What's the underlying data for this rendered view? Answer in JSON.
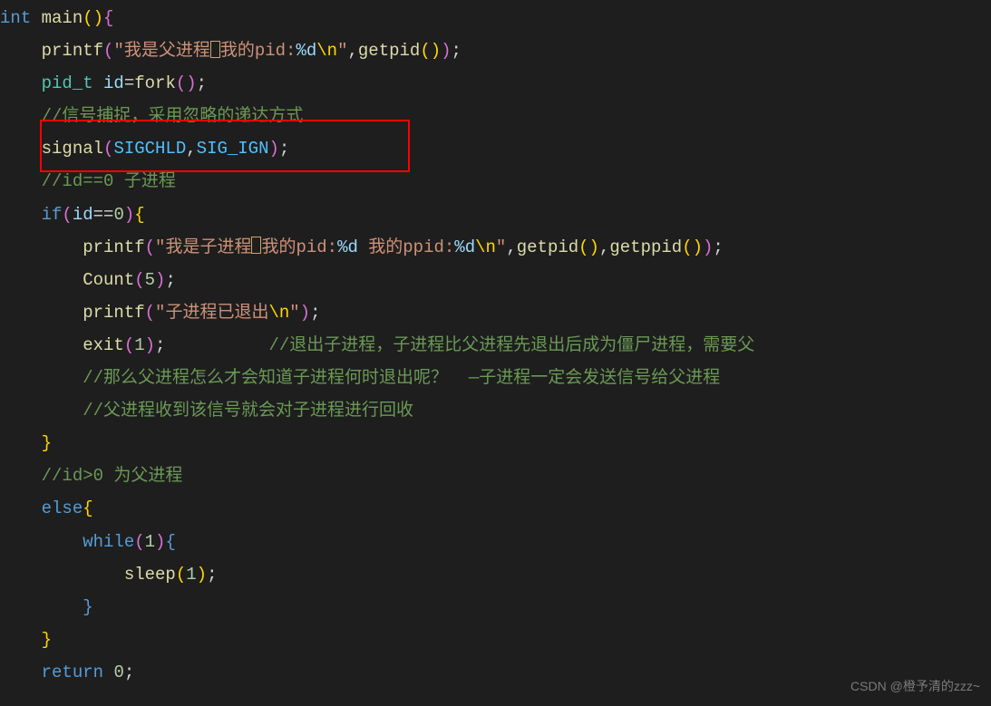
{
  "lines": [
    {
      "indent": "",
      "tokens": [
        {
          "t": "int ",
          "c": "kw"
        },
        {
          "t": "main",
          "c": "fn"
        },
        {
          "t": "()",
          "c": "brace2"
        },
        {
          "t": "{",
          "c": "brace"
        }
      ]
    },
    {
      "indent": "    ",
      "tokens": [
        {
          "t": "printf",
          "c": "fn"
        },
        {
          "t": "(",
          "c": "brace"
        },
        {
          "t": "\"我是父进程",
          "c": "str"
        },
        {
          "t": "",
          "c": "highlight-box"
        },
        {
          "t": "我的pid:",
          "c": "str"
        },
        {
          "t": "%d",
          "c": "var"
        },
        {
          "t": "\\n",
          "c": "brace2"
        },
        {
          "t": "\"",
          "c": "str"
        },
        {
          "t": ",",
          "c": "punct"
        },
        {
          "t": "getpid",
          "c": "fn"
        },
        {
          "t": "()",
          "c": "brace2"
        },
        {
          "t": ")",
          "c": "brace"
        },
        {
          "t": ";",
          "c": "punct"
        }
      ]
    },
    {
      "indent": "    ",
      "tokens": [
        {
          "t": "pid_t",
          "c": "type"
        },
        {
          "t": " ",
          "c": "punct"
        },
        {
          "t": "id",
          "c": "var"
        },
        {
          "t": "=",
          "c": "punct"
        },
        {
          "t": "fork",
          "c": "fn"
        },
        {
          "t": "()",
          "c": "brace"
        },
        {
          "t": ";",
          "c": "punct"
        }
      ]
    },
    {
      "indent": "    ",
      "tokens": [
        {
          "t": "//信号捕捉，采用忽略的递达方式",
          "c": "cmt"
        }
      ]
    },
    {
      "indent": "    ",
      "tokens": [
        {
          "t": "signal",
          "c": "fn"
        },
        {
          "t": "(",
          "c": "brace"
        },
        {
          "t": "SIGCHLD",
          "c": "const"
        },
        {
          "t": ",",
          "c": "punct"
        },
        {
          "t": "SIG_IGN",
          "c": "const"
        },
        {
          "t": ")",
          "c": "brace"
        },
        {
          "t": ";",
          "c": "punct"
        }
      ]
    },
    {
      "indent": "",
      "tokens": []
    },
    {
      "indent": "    ",
      "tokens": [
        {
          "t": "//id==0 子进程",
          "c": "cmt"
        }
      ]
    },
    {
      "indent": "    ",
      "tokens": [
        {
          "t": "if",
          "c": "kw"
        },
        {
          "t": "(",
          "c": "brace"
        },
        {
          "t": "id",
          "c": "var"
        },
        {
          "t": "==",
          "c": "punct"
        },
        {
          "t": "0",
          "c": "num"
        },
        {
          "t": ")",
          "c": "brace"
        },
        {
          "t": "{",
          "c": "brace2"
        }
      ]
    },
    {
      "indent": "        ",
      "tokens": [
        {
          "t": "printf",
          "c": "fn"
        },
        {
          "t": "(",
          "c": "brace"
        },
        {
          "t": "\"我是子进程",
          "c": "str"
        },
        {
          "t": "",
          "c": "highlight-box"
        },
        {
          "t": "我的pid:",
          "c": "str"
        },
        {
          "t": "%d",
          "c": "var"
        },
        {
          "t": " 我的ppid:",
          "c": "str"
        },
        {
          "t": "%d",
          "c": "var"
        },
        {
          "t": "\\n",
          "c": "brace2"
        },
        {
          "t": "\"",
          "c": "str"
        },
        {
          "t": ",",
          "c": "punct"
        },
        {
          "t": "getpid",
          "c": "fn"
        },
        {
          "t": "()",
          "c": "brace2"
        },
        {
          "t": ",",
          "c": "punct"
        },
        {
          "t": "getppid",
          "c": "fn"
        },
        {
          "t": "()",
          "c": "brace2"
        },
        {
          "t": ")",
          "c": "brace"
        },
        {
          "t": ";",
          "c": "punct"
        }
      ]
    },
    {
      "indent": "        ",
      "tokens": [
        {
          "t": "Count",
          "c": "fn"
        },
        {
          "t": "(",
          "c": "brace"
        },
        {
          "t": "5",
          "c": "num"
        },
        {
          "t": ")",
          "c": "brace"
        },
        {
          "t": ";",
          "c": "punct"
        }
      ]
    },
    {
      "indent": "        ",
      "tokens": [
        {
          "t": "printf",
          "c": "fn"
        },
        {
          "t": "(",
          "c": "brace"
        },
        {
          "t": "\"子进程已退出",
          "c": "str"
        },
        {
          "t": "\\n",
          "c": "brace2"
        },
        {
          "t": "\"",
          "c": "str"
        },
        {
          "t": ")",
          "c": "brace"
        },
        {
          "t": ";",
          "c": "punct"
        }
      ]
    },
    {
      "indent": "        ",
      "tokens": [
        {
          "t": "exit",
          "c": "fn"
        },
        {
          "t": "(",
          "c": "brace"
        },
        {
          "t": "1",
          "c": "num"
        },
        {
          "t": ")",
          "c": "brace"
        },
        {
          "t": ";",
          "c": "punct"
        },
        {
          "t": "          ",
          "c": "punct"
        },
        {
          "t": "//退出子进程，子进程比父进程先退出后成为僵尸进程，需要父",
          "c": "cmt"
        }
      ]
    },
    {
      "indent": "        ",
      "tokens": [
        {
          "t": "//那么父进程怎么才会知道子进程何时退出呢？  —子进程一定会发送信号给父进程",
          "c": "cmt"
        }
      ]
    },
    {
      "indent": "        ",
      "tokens": [
        {
          "t": "//父进程收到该信号就会对子进程进行回收",
          "c": "cmt"
        }
      ]
    },
    {
      "indent": "    ",
      "tokens": [
        {
          "t": "}",
          "c": "brace2"
        }
      ]
    },
    {
      "indent": "    ",
      "tokens": [
        {
          "t": "//id>0 为父进程",
          "c": "cmt"
        }
      ]
    },
    {
      "indent": "    ",
      "tokens": [
        {
          "t": "else",
          "c": "kw"
        },
        {
          "t": "{",
          "c": "brace2"
        }
      ]
    },
    {
      "indent": "        ",
      "tokens": [
        {
          "t": "while",
          "c": "kw"
        },
        {
          "t": "(",
          "c": "brace"
        },
        {
          "t": "1",
          "c": "num"
        },
        {
          "t": ")",
          "c": "brace"
        },
        {
          "t": "{",
          "c": "kw"
        }
      ]
    },
    {
      "indent": "            ",
      "tokens": [
        {
          "t": "sleep",
          "c": "fn"
        },
        {
          "t": "(",
          "c": "brace2"
        },
        {
          "t": "1",
          "c": "num"
        },
        {
          "t": ")",
          "c": "brace2"
        },
        {
          "t": ";",
          "c": "punct"
        }
      ]
    },
    {
      "indent": "        ",
      "tokens": [
        {
          "t": "}",
          "c": "kw"
        }
      ]
    },
    {
      "indent": "    ",
      "tokens": [
        {
          "t": "}",
          "c": "brace2"
        }
      ]
    },
    {
      "indent": "    ",
      "tokens": [
        {
          "t": "return ",
          "c": "kw"
        },
        {
          "t": "0",
          "c": "num"
        },
        {
          "t": ";",
          "c": "punct"
        }
      ]
    }
  ],
  "watermark": "CSDN @橙予清的zzz~"
}
